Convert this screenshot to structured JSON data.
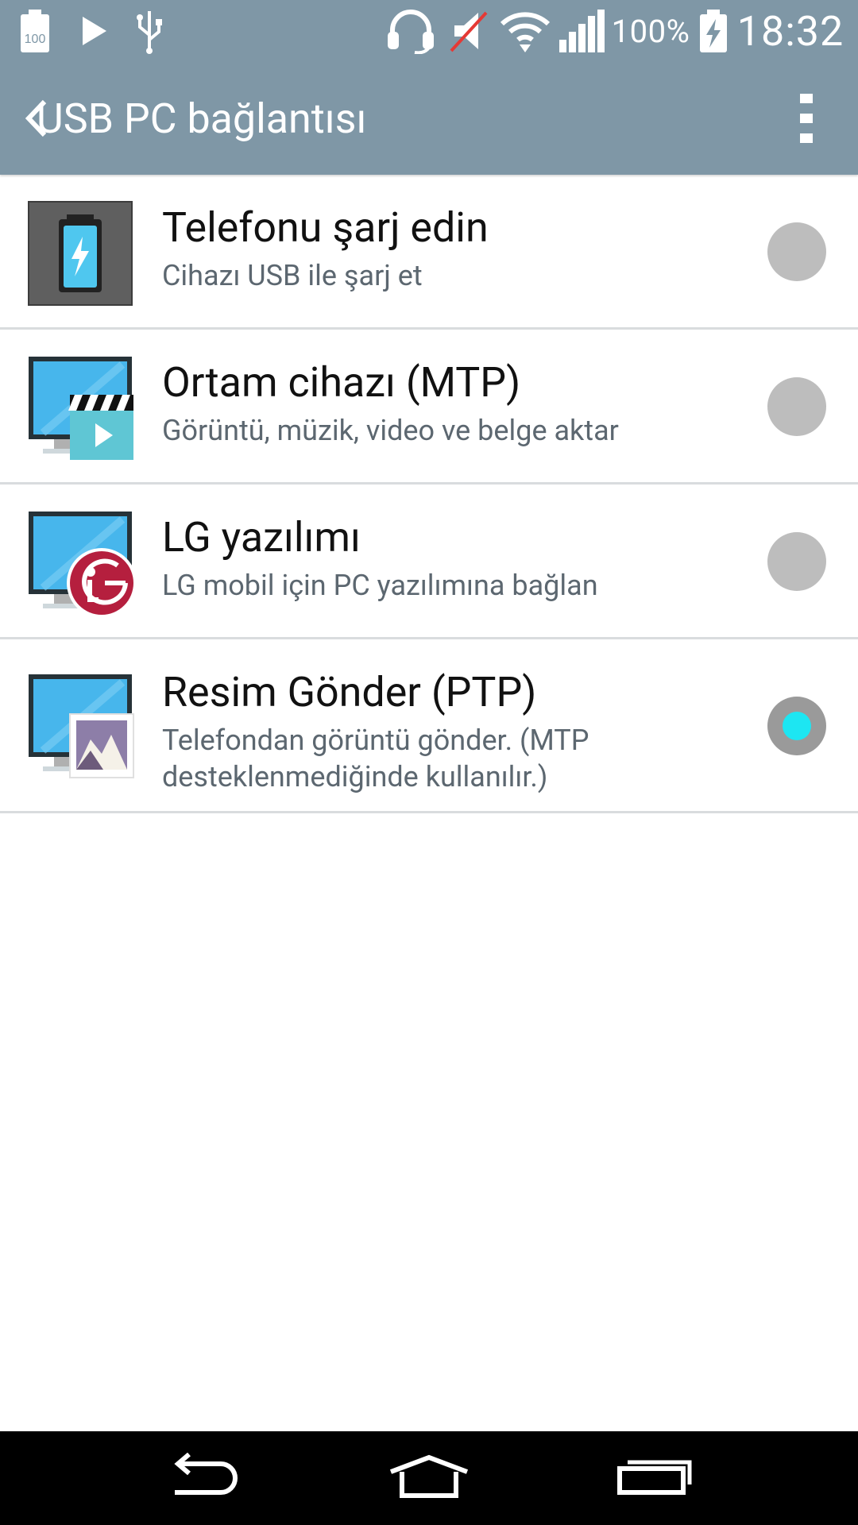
{
  "status_bar": {
    "battery_small_label": "100",
    "battery_percent": "100%",
    "time": "18:32",
    "icons": [
      "battery-100-icon",
      "play-icon",
      "usb-icon",
      "headset-icon",
      "mute-icon",
      "wifi-icon",
      "signal-icon",
      "battery-charging-icon"
    ]
  },
  "app_bar": {
    "title": "USB PC bağlantısı",
    "back_icon": "chevron-left-icon",
    "menu_icon": "overflow-menu-icon"
  },
  "options": [
    {
      "title": "Telefonu şarj edin",
      "description": "Cihazı USB ile şarj et",
      "icon": "charge-phone-icon",
      "selected": false
    },
    {
      "title": "Ortam cihazı (MTP)",
      "description": "Görüntü, müzik, video ve belge aktar",
      "icon": "media-device-icon",
      "selected": false
    },
    {
      "title": "LG yazılımı",
      "description": "LG mobil için PC yazılımına bağlan",
      "icon": "lg-software-icon",
      "icon_text": "LG",
      "selected": false
    },
    {
      "title": "Resim Gönder (PTP)",
      "description": "Telefondan görüntü gönder. (MTP desteklenmediğinde kullanılır.)",
      "icon": "send-picture-icon",
      "selected": true
    }
  ],
  "colors": {
    "header": "#7f97a6",
    "radio_off": "#bdbdbd",
    "radio_selected_dot": "#1de6f2",
    "divider": "#d9dcde",
    "nav_bar": "#000000"
  },
  "nav_bar": {
    "buttons": [
      "back-icon",
      "home-icon",
      "recent-apps-icon"
    ]
  }
}
